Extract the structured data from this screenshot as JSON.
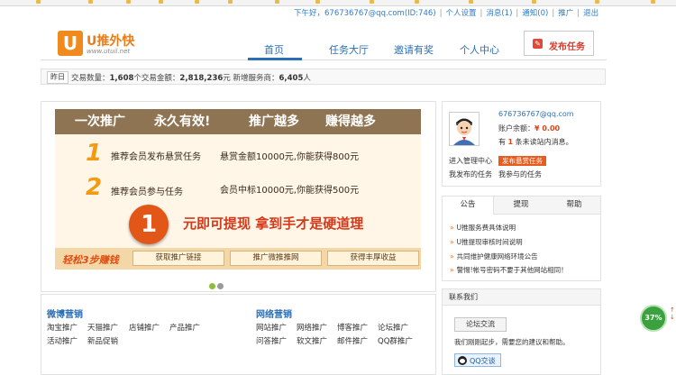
{
  "top_links": {
    "greeting": "下午好，676736767@qq.com(ID:746)",
    "personal_settings": "个人设置",
    "messages": "消息(1)",
    "notifications": "通知(0)",
    "promote": "推广",
    "logout": "退出"
  },
  "logo": {
    "mark": "U",
    "name": "U推外快",
    "url": "www.utuil.net"
  },
  "nav": {
    "items": [
      "首页",
      "任务大厅",
      "邀请有奖",
      "个人中心"
    ],
    "active": "首页",
    "publish_button": "发布任务",
    "publish_icon": "edit-icon"
  },
  "stats": {
    "tab": "昨日",
    "tx_label": "交易数量：",
    "tx_count": "1,608",
    "tx_unit": "个交易金额：",
    "tx_amount": "2,818,236",
    "new_label": "元 新增服务商：",
    "new_count": "6,405",
    "new_unit": "人"
  },
  "banner": {
    "headline_1": "一次推广",
    "headline_2": "永久有效!",
    "headline_3": "推广越多",
    "headline_4": "赚得越多",
    "line1_num": "1",
    "line1_text": "推荐会员发布悬赏任务",
    "line1_reward": "悬赏金额10000元,你能获得800元",
    "line2_num": "2",
    "line2_text": "推荐会员参与任务",
    "line2_reward": "会员中标10000元,你能获得500元",
    "big_num": "1",
    "slogan": "元即可提现 拿到手才是硬道理",
    "steps": "轻松3步赚钱",
    "buttons": [
      "获取推广链接",
      "推广微推推网",
      "获得丰厚收益"
    ],
    "carousel_dots": 2
  },
  "user": {
    "email": "676736767@qq.com",
    "balance_label": "账户余额：",
    "balance_value": "¥ 0.00",
    "msg_prefix": "有",
    "msg_count": "1",
    "msg_suffix": "条未读站内消息。",
    "manage_center": "进入管理中心",
    "publish_reward_btn": "发布悬赏任务",
    "my_tasks": "我发布的任务",
    "joined_tasks": "我参与的任务",
    "avatar_icon": "user-avatar-icon"
  },
  "notice": {
    "tabs": [
      "公告",
      "提现",
      "帮助"
    ],
    "items": [
      "U推服务费具体说明",
      "U推提现审核时间说明",
      "共同维护健康网络环境公告",
      "警惕!帐号密码不要于其他网站相同！"
    ]
  },
  "categories": {
    "weibo_title": "微博营销",
    "weibo_links": [
      [
        "淘宝推广",
        "天猫推广",
        "店铺推广",
        "产品推广"
      ],
      [
        "活动推广",
        "新品促销"
      ]
    ],
    "web_title": "网络营销",
    "web_links": [
      [
        "网站推广",
        "网络推广",
        "博客推广",
        "论坛推广"
      ],
      [
        "问答推广",
        "软文推广",
        "邮件推广",
        "QQ群推广"
      ]
    ]
  },
  "contact": {
    "title": "联系我们",
    "exchange_button": "论坛交流",
    "text": "我们刚刚起步，需要您的建议和帮助。",
    "qq_button": "QQ交谈"
  },
  "speed_badge": "37%",
  "colors": {
    "brand_orange": "#f08a1d",
    "link_blue": "#2c6fb7",
    "accent_red": "#d93a2b",
    "badge_green": "#3aa13e"
  }
}
